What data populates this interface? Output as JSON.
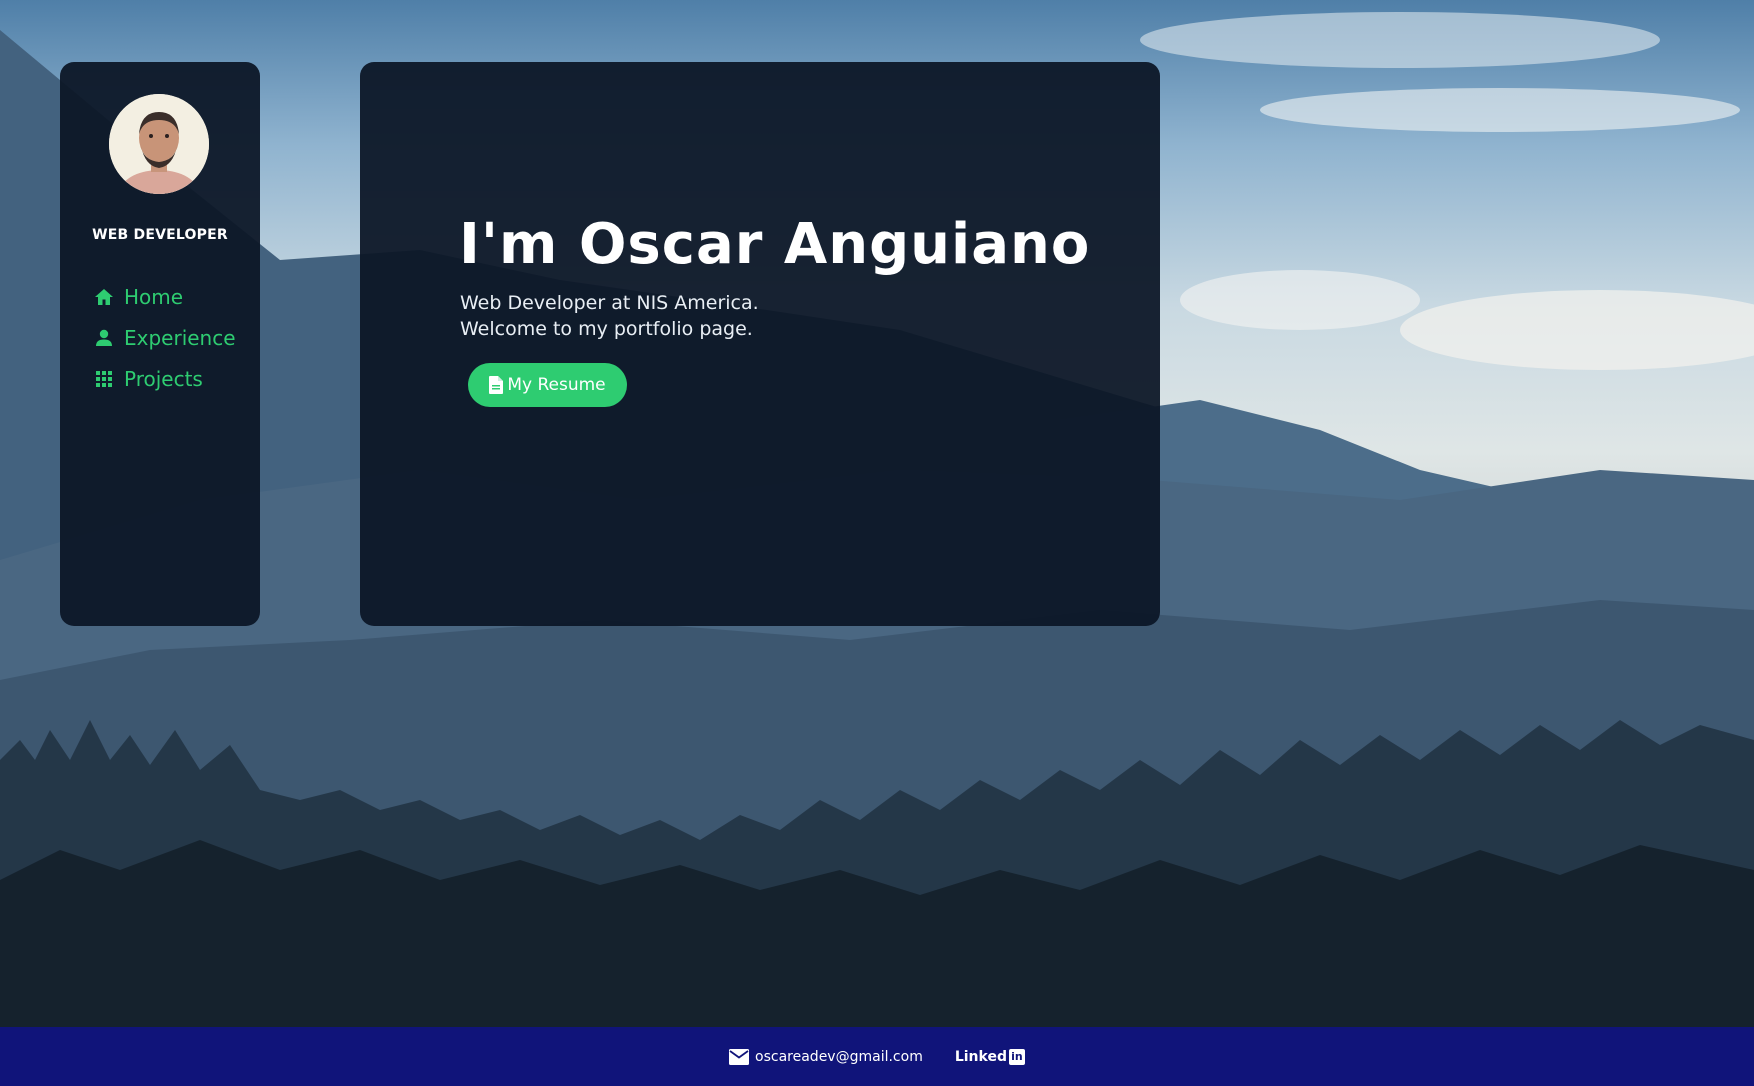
{
  "sidebar": {
    "role": "WEB DEVELOPER",
    "items": [
      {
        "label": "Home",
        "icon": "home-icon"
      },
      {
        "label": "Experience",
        "icon": "person-icon"
      },
      {
        "label": "Projects",
        "icon": "grid-icon"
      }
    ]
  },
  "hero": {
    "title": "I'm Oscar Anguiano",
    "subtitle_line1": "Web Developer at NIS America.",
    "subtitle_line2": "Welcome to my portfolio page.",
    "button_label": "My Resume",
    "button_icon": "file-icon"
  },
  "footer": {
    "email": "oscareadev@gmail.com",
    "linkedin_text": "Linked",
    "linkedin_box": "in"
  },
  "colors": {
    "accent": "#2ecc71",
    "panel": "#0c1626",
    "footer": "#10147a"
  }
}
